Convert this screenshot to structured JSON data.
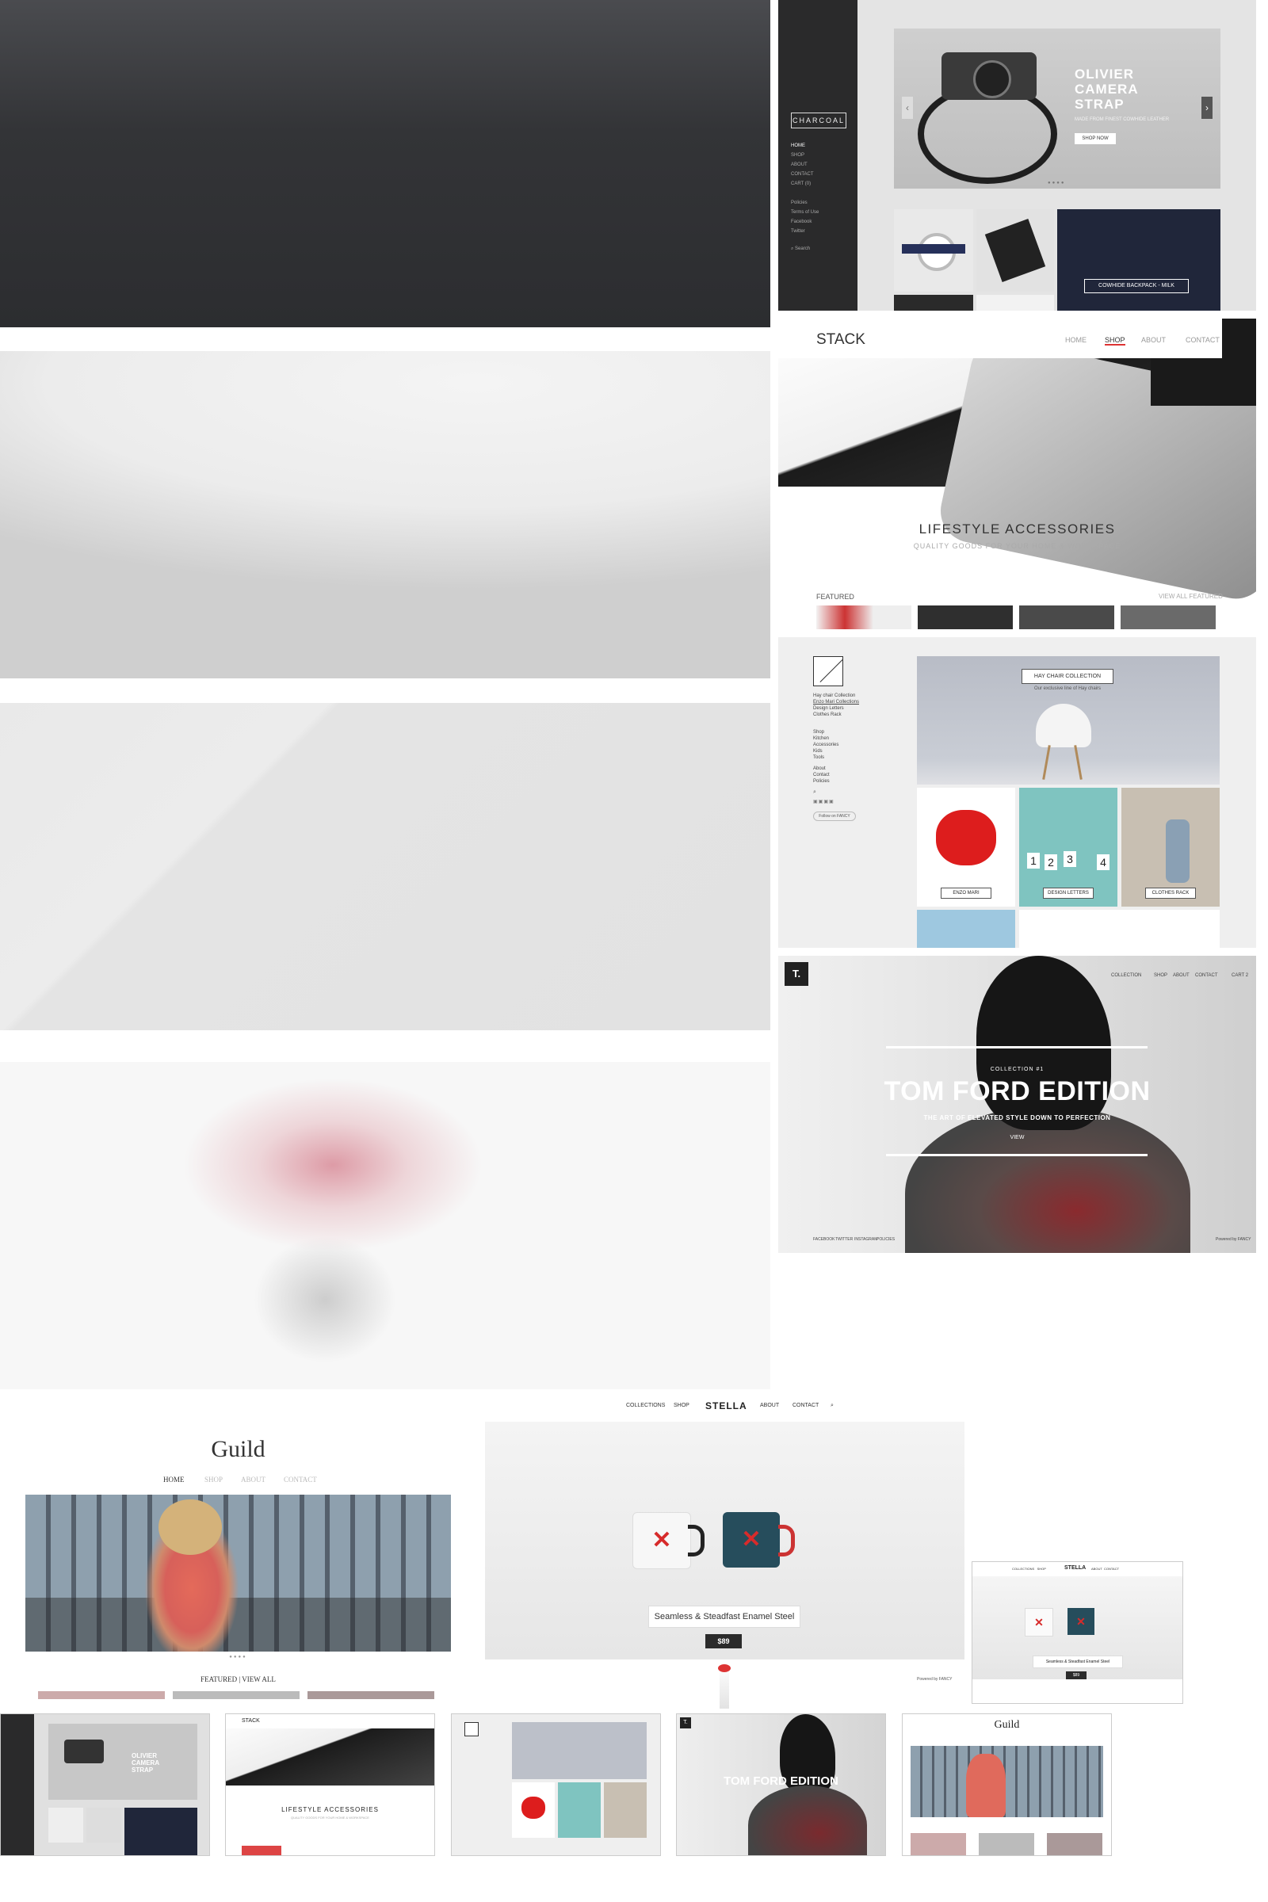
{
  "charcoal": {
    "logo": "CHARCOAL",
    "nav": [
      "HOME",
      "SHOP",
      "ABOUT",
      "CONTACT",
      "CART (0)"
    ],
    "links": [
      "Policies",
      "Terms of Use",
      "Facebook",
      "Twitter"
    ],
    "search": "Search",
    "hero_title": "OLIVIER CAMERA STRAP",
    "hero_sub": "MADE FROM FINEST COWHIDE LEATHER",
    "hero_button": "SHOP NOW",
    "tile_label": "COWHIDE BACKPACK - MILK"
  },
  "stack": {
    "brand": "STACK",
    "menu": [
      "HOME",
      "SHOP",
      "ABOUT",
      "CONTACT"
    ],
    "heading": "LIFESTYLE ACCESSORIES",
    "subheading": "QUALITY GOODS FOR YOUR HOME & WORKSPACE",
    "featured": "FEATURED",
    "view_all": "VIEW ALL FEATURED"
  },
  "hay": {
    "nav1": [
      "Hay chair Collection",
      "Enzo Mari Collections",
      "Design Letters",
      "Clothes Rack"
    ],
    "nav2": [
      "Shop",
      "Kitchen",
      "Accessories",
      "Kids",
      "Tools"
    ],
    "nav3": [
      "About",
      "Contact",
      "Policies"
    ],
    "follow": "Follow on FANCY",
    "badge": "HAY CHAIR COLLECTION",
    "sub": "Our exclusive line of Hay chairs",
    "labels": [
      "ENZO MARI",
      "DESIGN LETTERS",
      "CLOTHES RACK"
    ],
    "digits": [
      "1",
      "2",
      "3",
      "4"
    ]
  },
  "tom": {
    "logo": "T.",
    "nav": [
      "COLLECTION",
      "SHOP",
      "ABOUT",
      "CONTACT",
      "CART 2"
    ],
    "collection": "COLLECTION #1",
    "title": "TOM FORD EDITION",
    "subtitle": "THE ART OF ELEVATED STYLE DOWN TO PERFECTION",
    "view": "VIEW",
    "footer": [
      "FACEBOOK",
      "TWITTER",
      "INSTAGRAM",
      "POLICIES"
    ],
    "powered": "Powered by FANCY"
  },
  "guild": {
    "title": "Guild",
    "nav": [
      "HOME",
      "SHOP",
      "ABOUT",
      "CONTACT"
    ],
    "featured": "FEATURED",
    "view_all": "VIEW ALL"
  },
  "stella": {
    "nav_left": [
      "COLLECTIONS",
      "SHOP"
    ],
    "brand": "STELLA",
    "nav_right": [
      "ABOUT",
      "CONTACT"
    ],
    "product": "Seamless & Steadfast Enamel Steel",
    "price": "$89",
    "powered": "Powered by FANCY"
  },
  "thumbs": {
    "charcoal_title": "OLIVIER CAMERA STRAP",
    "stack_heading": "LIFESTYLE ACCESSORIES",
    "tom_title": "TOM FORD EDITION",
    "guild_title": "Guild"
  }
}
